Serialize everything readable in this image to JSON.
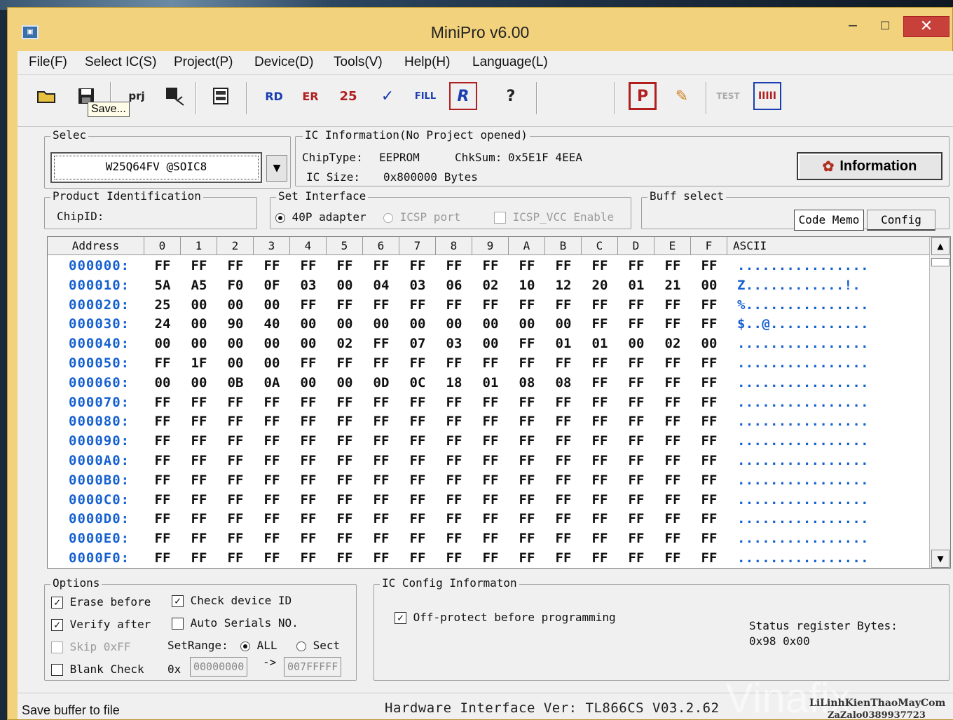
{
  "window": {
    "title": "MiniPro v6.00",
    "min": "‒",
    "max": "☐",
    "close": "✕",
    "icon": "app-icon"
  },
  "menu": [
    "File(F)",
    "Select IC(S)",
    "Project(P)",
    "Device(D)",
    "Tools(V)",
    "Help(H)",
    "Language(L)"
  ],
  "toolbar": {
    "tooltip": "Save...",
    "buttons": [
      {
        "name": "open-icon",
        "glyph": "📂"
      },
      {
        "name": "save-icon",
        "glyph": "💾"
      },
      {
        "name": "open-project-icon",
        "glyph": "prj"
      },
      {
        "name": "save-project-icon",
        "glyph": "▤"
      },
      {
        "name": "memory-icon",
        "glyph": "▦"
      },
      {
        "name": "read-icon",
        "glyph": "RD"
      },
      {
        "name": "erase-icon",
        "glyph": "ER"
      },
      {
        "name": "blank-check-icon",
        "glyph": "25"
      },
      {
        "name": "verify-icon",
        "glyph": "✓"
      },
      {
        "name": "fill-icon",
        "glyph": "FILL"
      },
      {
        "name": "read-chip-icon",
        "glyph": "R"
      },
      {
        "name": "help-icon",
        "glyph": "?"
      },
      {
        "name": "program-icon",
        "glyph": "P"
      },
      {
        "name": "edit-icon",
        "glyph": "✎"
      },
      {
        "name": "test-icon",
        "glyph": "TEST"
      },
      {
        "name": "chip-icon",
        "glyph": "IIIII"
      }
    ]
  },
  "select_ic": {
    "legend": "Selec",
    "chip": "W25Q64FV @SOIC8",
    "arrow": "▼"
  },
  "ic_info": {
    "legend": "IC Information(No Project opened)",
    "chiptype_label": "ChipType:",
    "chiptype": "EEPROM",
    "chksum_label": "ChkSum:",
    "chksum": "0x5E1F 4EEA",
    "icsize_label": "IC Size:",
    "icsize": "0x800000 Bytes",
    "info_button": "Information"
  },
  "product_id": {
    "legend": "Product Identification",
    "chipid_label": "ChipID:"
  },
  "interface": {
    "legend": "Set Interface",
    "adapter": "40P adapter",
    "icsp": "ICSP port",
    "icsp_vcc": "ICSP_VCC Enable"
  },
  "buff_select": {
    "legend": "Buff select",
    "code_memo": "Code Memo",
    "config": "Config"
  },
  "grid": {
    "address_header": "Address",
    "columns": [
      "0",
      "1",
      "2",
      "3",
      "4",
      "5",
      "6",
      "7",
      "8",
      "9",
      "A",
      "B",
      "C",
      "D",
      "E",
      "F"
    ],
    "ascii_header": "ASCII",
    "rows": [
      {
        "addr": "000000:",
        "bytes": [
          "FF",
          "FF",
          "FF",
          "FF",
          "FF",
          "FF",
          "FF",
          "FF",
          "FF",
          "FF",
          "FF",
          "FF",
          "FF",
          "FF",
          "FF",
          "FF"
        ],
        "ascii": "................"
      },
      {
        "addr": "000010:",
        "bytes": [
          "5A",
          "A5",
          "F0",
          "0F",
          "03",
          "00",
          "04",
          "03",
          "06",
          "02",
          "10",
          "12",
          "20",
          "01",
          "21",
          "00"
        ],
        "ascii": "Z............!."
      },
      {
        "addr": "000020:",
        "bytes": [
          "25",
          "00",
          "00",
          "00",
          "FF",
          "FF",
          "FF",
          "FF",
          "FF",
          "FF",
          "FF",
          "FF",
          "FF",
          "FF",
          "FF",
          "FF"
        ],
        "ascii": "%..............."
      },
      {
        "addr": "000030:",
        "bytes": [
          "24",
          "00",
          "90",
          "40",
          "00",
          "00",
          "00",
          "00",
          "00",
          "00",
          "00",
          "00",
          "FF",
          "FF",
          "FF",
          "FF"
        ],
        "ascii": "$..@............"
      },
      {
        "addr": "000040:",
        "bytes": [
          "00",
          "00",
          "00",
          "00",
          "00",
          "02",
          "FF",
          "07",
          "03",
          "00",
          "FF",
          "01",
          "01",
          "00",
          "02",
          "00"
        ],
        "ascii": "................"
      },
      {
        "addr": "000050:",
        "bytes": [
          "FF",
          "1F",
          "00",
          "00",
          "FF",
          "FF",
          "FF",
          "FF",
          "FF",
          "FF",
          "FF",
          "FF",
          "FF",
          "FF",
          "FF",
          "FF"
        ],
        "ascii": "................"
      },
      {
        "addr": "000060:",
        "bytes": [
          "00",
          "00",
          "0B",
          "0A",
          "00",
          "00",
          "0D",
          "0C",
          "18",
          "01",
          "08",
          "08",
          "FF",
          "FF",
          "FF",
          "FF"
        ],
        "ascii": "................"
      },
      {
        "addr": "000070:",
        "bytes": [
          "FF",
          "FF",
          "FF",
          "FF",
          "FF",
          "FF",
          "FF",
          "FF",
          "FF",
          "FF",
          "FF",
          "FF",
          "FF",
          "FF",
          "FF",
          "FF"
        ],
        "ascii": "................"
      },
      {
        "addr": "000080:",
        "bytes": [
          "FF",
          "FF",
          "FF",
          "FF",
          "FF",
          "FF",
          "FF",
          "FF",
          "FF",
          "FF",
          "FF",
          "FF",
          "FF",
          "FF",
          "FF",
          "FF"
        ],
        "ascii": "................"
      },
      {
        "addr": "000090:",
        "bytes": [
          "FF",
          "FF",
          "FF",
          "FF",
          "FF",
          "FF",
          "FF",
          "FF",
          "FF",
          "FF",
          "FF",
          "FF",
          "FF",
          "FF",
          "FF",
          "FF"
        ],
        "ascii": "................"
      },
      {
        "addr": "0000A0:",
        "bytes": [
          "FF",
          "FF",
          "FF",
          "FF",
          "FF",
          "FF",
          "FF",
          "FF",
          "FF",
          "FF",
          "FF",
          "FF",
          "FF",
          "FF",
          "FF",
          "FF"
        ],
        "ascii": "................"
      },
      {
        "addr": "0000B0:",
        "bytes": [
          "FF",
          "FF",
          "FF",
          "FF",
          "FF",
          "FF",
          "FF",
          "FF",
          "FF",
          "FF",
          "FF",
          "FF",
          "FF",
          "FF",
          "FF",
          "FF"
        ],
        "ascii": "................"
      },
      {
        "addr": "0000C0:",
        "bytes": [
          "FF",
          "FF",
          "FF",
          "FF",
          "FF",
          "FF",
          "FF",
          "FF",
          "FF",
          "FF",
          "FF",
          "FF",
          "FF",
          "FF",
          "FF",
          "FF"
        ],
        "ascii": "................"
      },
      {
        "addr": "0000D0:",
        "bytes": [
          "FF",
          "FF",
          "FF",
          "FF",
          "FF",
          "FF",
          "FF",
          "FF",
          "FF",
          "FF",
          "FF",
          "FF",
          "FF",
          "FF",
          "FF",
          "FF"
        ],
        "ascii": "................"
      },
      {
        "addr": "0000E0:",
        "bytes": [
          "FF",
          "FF",
          "FF",
          "FF",
          "FF",
          "FF",
          "FF",
          "FF",
          "FF",
          "FF",
          "FF",
          "FF",
          "FF",
          "FF",
          "FF",
          "FF"
        ],
        "ascii": "................"
      },
      {
        "addr": "0000F0:",
        "bytes": [
          "FF",
          "FF",
          "FF",
          "FF",
          "FF",
          "FF",
          "FF",
          "FF",
          "FF",
          "FF",
          "FF",
          "FF",
          "FF",
          "FF",
          "FF",
          "FF"
        ],
        "ascii": "................"
      }
    ]
  },
  "options": {
    "legend": "Options",
    "erase_before": "Erase before",
    "check_device_id": "Check device ID",
    "verify_after": "Verify after",
    "auto_serials": "Auto Serials NO.",
    "skip_0xff": "Skip 0xFF",
    "set_range": "SetRange:",
    "range_all": "ALL",
    "range_sect": "Sect",
    "blank_check": "Blank Check",
    "ox": "0x",
    "range_start": "00000000",
    "arrow": "->",
    "range_end": "007FFFFF"
  },
  "ic_config": {
    "legend": "IC Config Informaton",
    "off_protect": "Off-protect before programming",
    "status_label": "Status register Bytes:",
    "status_value": "0x98 0x00"
  },
  "status": {
    "left": "Save buffer to file",
    "hw": "Hardware Interface Ver: TL866CS V03.2.62",
    "wm1": "LiLinhKienThaoMayCom",
    "wm2": "ZaZalo0389937723",
    "wm_bg": "Vinafix"
  },
  "colors": {
    "title_bar": "#f2d27c",
    "addr_blue": "#1560d0",
    "close_red": "#c7403a"
  }
}
